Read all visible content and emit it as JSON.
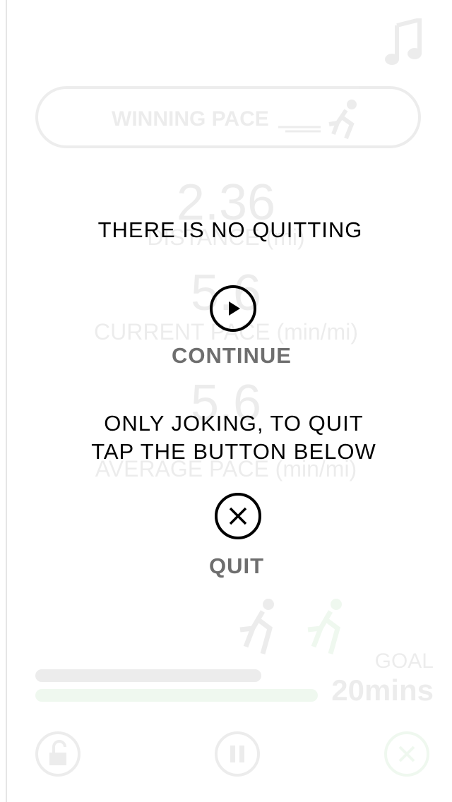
{
  "background": {
    "winning_pace_label": "WINNING PACE",
    "distance_value": "2.36",
    "distance_label": "DISTANCE (mi)",
    "current_pace_value": "5.6",
    "current_pace_label": "CURRENT PACE (min/mi)",
    "average_pace_value": "5.6",
    "average_pace_label": "AVERAGE PACE (min/mi)",
    "goal_label": "GOAL",
    "goal_value": "20mins"
  },
  "overlay": {
    "title": "THERE IS NO QUITTING",
    "continue_label": "CONTINUE",
    "message_line1": "ONLY JOKING, TO QUIT",
    "message_line2": "TAP THE BUTTON BELOW",
    "quit_label": "QUIT"
  },
  "colors": {
    "accent_green": "#2ea42e",
    "label_gray": "#6e6e6e",
    "text_black": "#000000"
  },
  "icons": [
    "music-note-icon",
    "runner-icon",
    "play-icon",
    "close-icon",
    "unlock-icon",
    "pause-icon"
  ]
}
